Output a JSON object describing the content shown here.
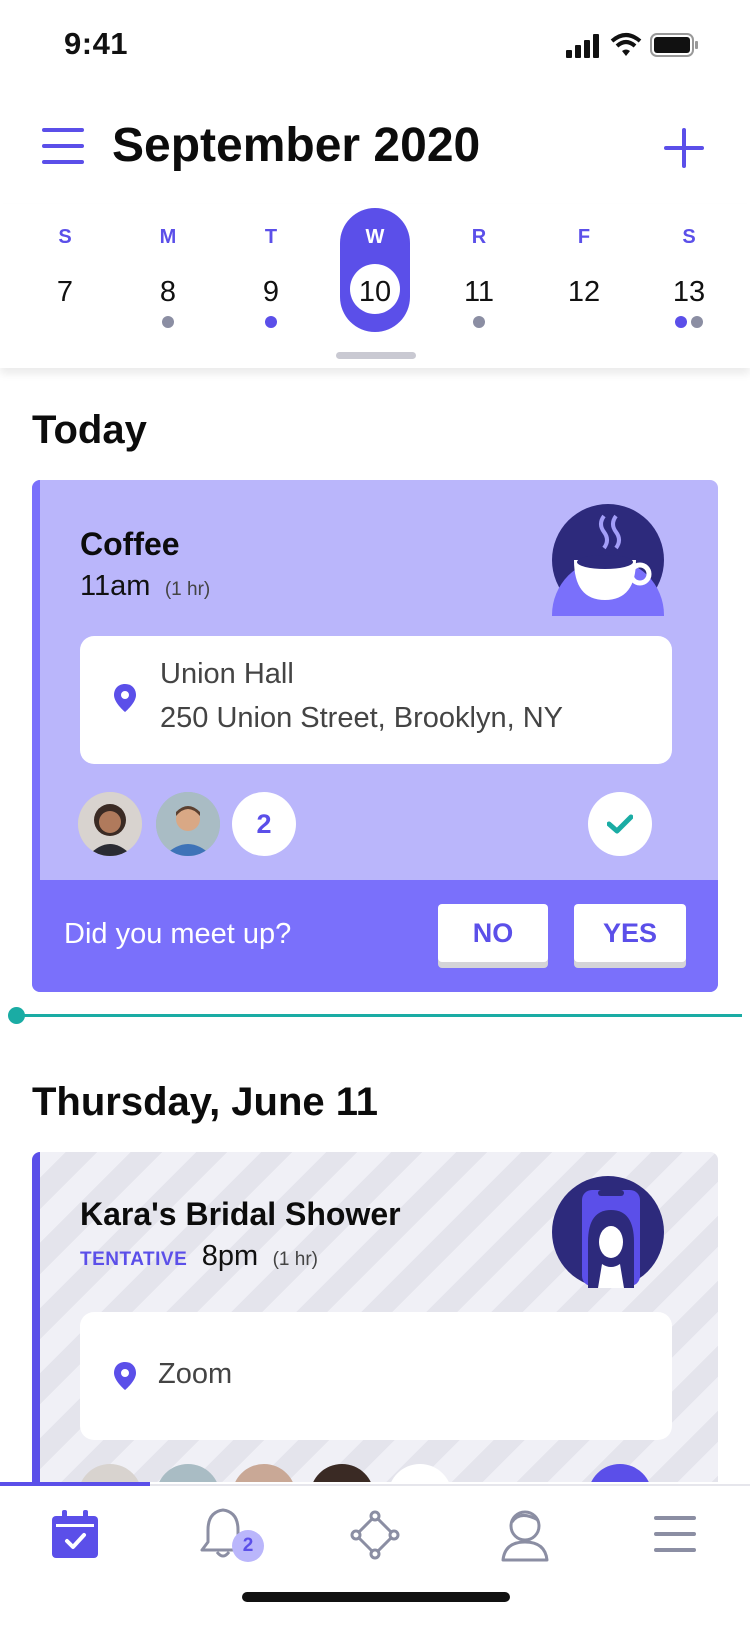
{
  "status_bar": {
    "time": "9:41"
  },
  "header": {
    "title": "September 2020"
  },
  "week": [
    {
      "letter": "S",
      "date": "7",
      "dots": []
    },
    {
      "letter": "M",
      "date": "8",
      "dots": [
        "#8b8ea3"
      ]
    },
    {
      "letter": "T",
      "date": "9",
      "dots": [
        "#5b4fe9"
      ]
    },
    {
      "letter": "W",
      "date": "10",
      "dots": [],
      "selected": true
    },
    {
      "letter": "R",
      "date": "11",
      "dots": [
        "#8b8ea3"
      ]
    },
    {
      "letter": "F",
      "date": "12",
      "dots": []
    },
    {
      "letter": "S",
      "date": "13",
      "dots": [
        "#5b4fe9",
        "#8b8ea3"
      ]
    }
  ],
  "today": {
    "heading": "Today",
    "event": {
      "title": "Coffee",
      "time": "11am",
      "duration": "(1 hr)",
      "icon": "coffee-cup-icon",
      "location_name": "Union Hall",
      "location_address": "250 Union Street, Brooklyn, NY",
      "extra_attendees": "2",
      "prompt": "Did you meet up?",
      "no_label": "NO",
      "yes_label": "YES"
    }
  },
  "upcoming": {
    "heading": "Thursday, June 11",
    "event": {
      "title": "Kara's Bridal Shower",
      "status": "TENTATIVE",
      "time": "8pm",
      "duration": "(1 hr)",
      "icon": "video-call-icon",
      "location_name": "Zoom"
    }
  },
  "tabbar": {
    "notifications_count": "2",
    "tabs": [
      "calendar",
      "notifications",
      "connections",
      "profile",
      "menu"
    ]
  },
  "colors": {
    "accent": "#5b4fe9",
    "card": "#bab6fb",
    "card_footer": "#7a70fb",
    "timeline": "#1aaca4"
  }
}
